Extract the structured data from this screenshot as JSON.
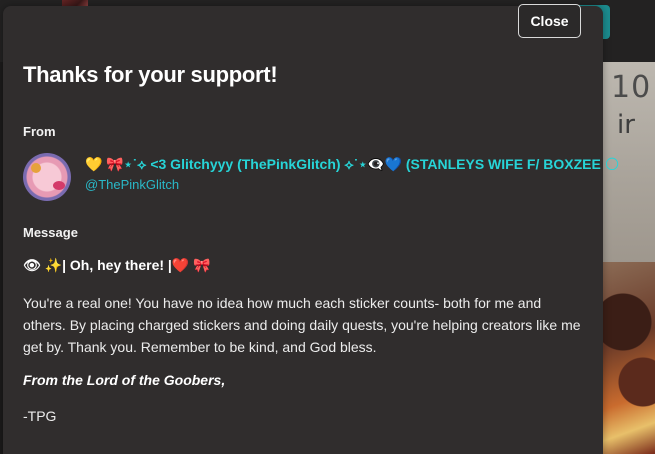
{
  "background": {
    "panel_text_top": "10",
    "panel_text_mid": "ir"
  },
  "modal": {
    "close_label": "Close",
    "title": "Thanks for your support!",
    "from_label": "From",
    "sender": {
      "display_name": "💛 🎀⋆˙⟡ <3 Glitchyyy (ThePinkGlitch) ⟡˙⋆👁‍🗨💙 (STANLEYS WIFE F/ BOXZEE 🌕",
      "handle": "@ThePinkGlitch"
    },
    "message_label": "Message",
    "message": {
      "heading": "👁 ✨| Oh, hey there! |❤️ 🎀",
      "body": "You're a real one! You have no idea how much each sticker counts- both for me and others. By placing charged stickers and doing daily quests, you're helping creators like me get by. Thank you. Remember to be kind, and God bless.",
      "signoff": "From the Lord of the Goobers,",
      "signature": "-TPG"
    }
  },
  "colors": {
    "modal_bg": "#302d2d",
    "accent_teal": "#27d4d7",
    "handle_teal": "#2ab8c7",
    "background_button": "#1c8c8f"
  }
}
